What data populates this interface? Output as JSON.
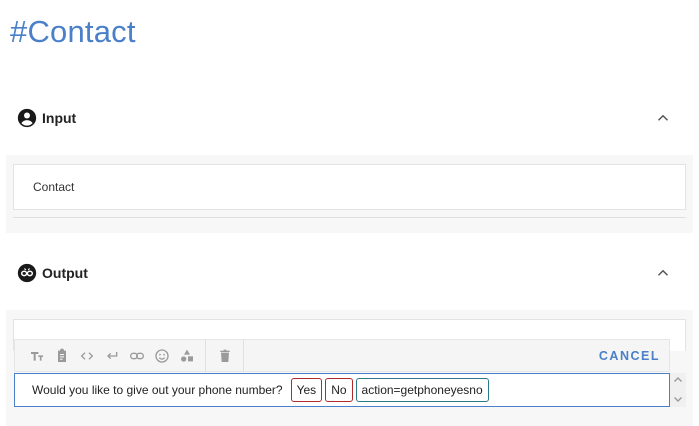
{
  "page": {
    "title": "#Contact"
  },
  "input_section": {
    "label": "Input",
    "icon": "account-circle-icon",
    "value": "Contact"
  },
  "output_section": {
    "label": "Output",
    "icon": "infinity-bot-icon",
    "ghost_text": "..."
  },
  "toolbar": {
    "icons": [
      "text-format-icon",
      "clipboard-icon",
      "code-icon",
      "return-icon",
      "link-icon",
      "emoji-icon",
      "shapes-icon",
      "delete-icon"
    ],
    "cancel_label": "CANCEL"
  },
  "editor": {
    "message": "Would you like to give out your phone number?",
    "chips": [
      {
        "text": "Yes",
        "kind": "button"
      },
      {
        "text": "No",
        "kind": "button"
      },
      {
        "text": "action=getphoneyesno",
        "kind": "action"
      }
    ]
  },
  "colors": {
    "accent": "#4a7fc9",
    "chip_button_border": "#b22a2a",
    "chip_action_border": "#2b7a8a"
  }
}
